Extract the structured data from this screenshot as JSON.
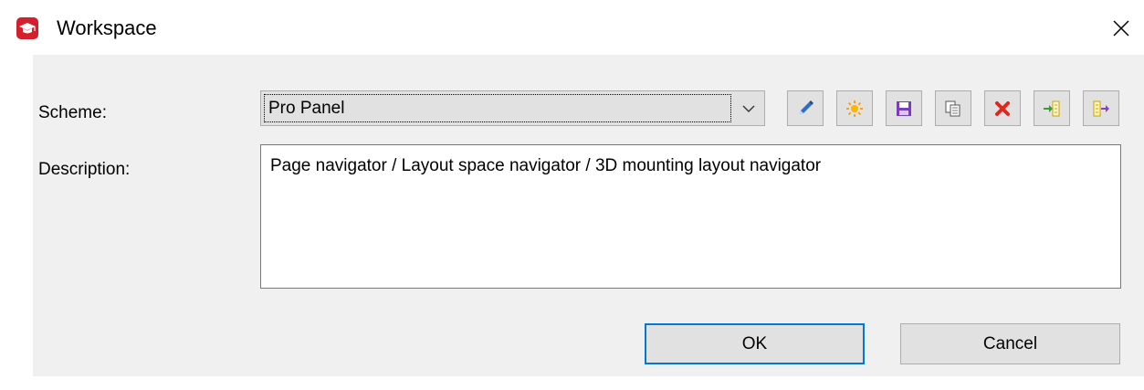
{
  "window": {
    "title": "Workspace",
    "app_icon": "graduation-cap-icon",
    "close_glyph": "×"
  },
  "scheme": {
    "label": "Scheme:",
    "selected": "Pro Panel"
  },
  "toolbar": {
    "buttons": [
      {
        "name": "edit-button",
        "icon": "pencil-icon"
      },
      {
        "name": "new-button",
        "icon": "sun-icon"
      },
      {
        "name": "save-button",
        "icon": "floppy-disk-icon"
      },
      {
        "name": "copy-button",
        "icon": "copy-icon"
      },
      {
        "name": "delete-button",
        "icon": "red-x-icon"
      },
      {
        "name": "import-button",
        "icon": "import-icon"
      },
      {
        "name": "export-button",
        "icon": "export-icon"
      }
    ]
  },
  "description": {
    "label": "Description:",
    "value": "Page navigator / Layout space navigator / 3D mounting layout navigator"
  },
  "footer": {
    "ok_label": "OK",
    "cancel_label": "Cancel"
  },
  "colors": {
    "app_icon_red": "#d41f2c",
    "dialog_gray": "#f0f0f0",
    "button_gray": "#e1e1e1",
    "focus_blue": "#0078d7"
  }
}
